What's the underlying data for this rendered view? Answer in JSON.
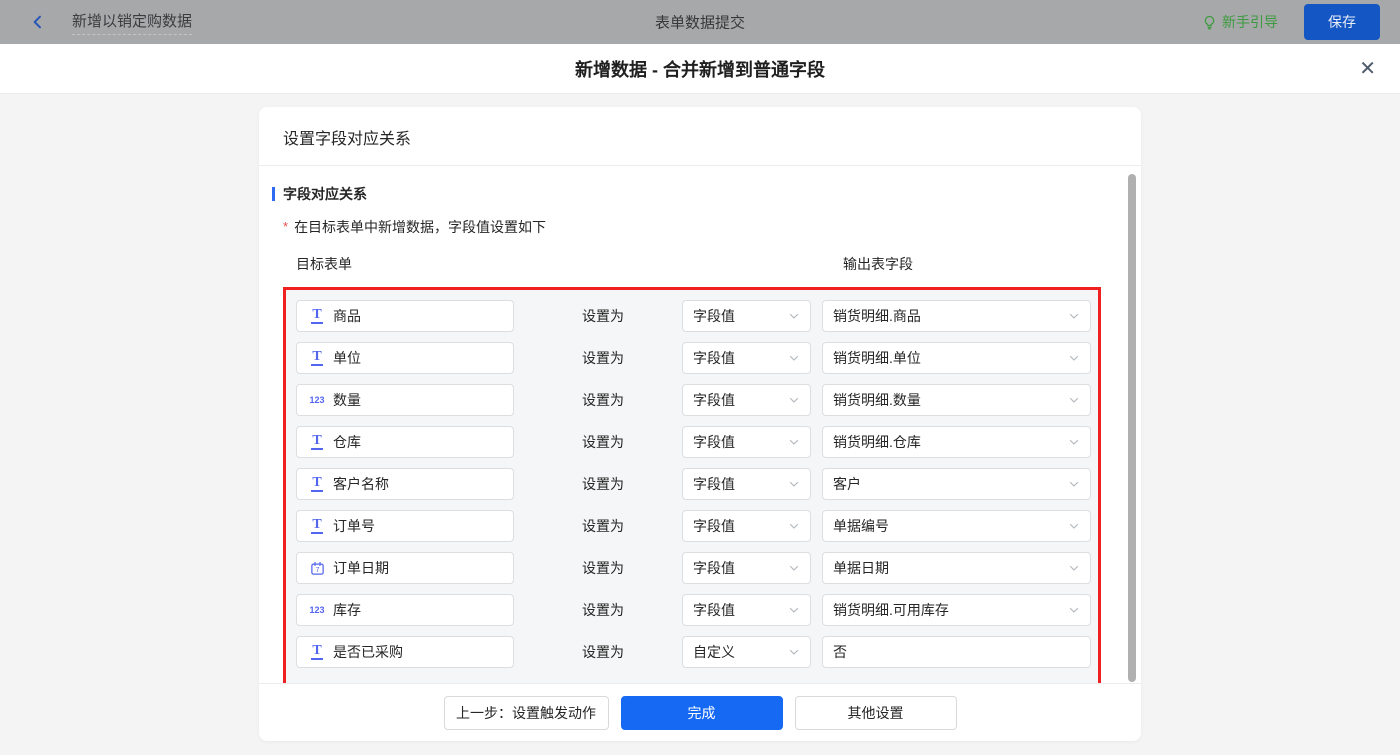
{
  "topbar": {
    "back_icon": "chevron-left",
    "flow_name": "新增以销定购数据",
    "center_title": "表单数据提交",
    "guide_icon": "lightbulb-icon",
    "guide_label": "新手引导",
    "save_label": "保存"
  },
  "modal": {
    "title": "新增数据 - 合并新增到普通字段",
    "close_glyph": "✕"
  },
  "card": {
    "header": "设置字段对应关系",
    "section_title": "字段对应关系",
    "required_star": "*",
    "required_note": "在目标表单中新增数据，字段值设置如下",
    "col_left": "目标表单",
    "col_right": "输出表字段",
    "set_as_label": "设置为",
    "rows": [
      {
        "icon": "text-field-icon",
        "field": "商品",
        "mode": "字段值",
        "value": "销货明细.商品",
        "value_is_select": true
      },
      {
        "icon": "text-field-icon",
        "field": "单位",
        "mode": "字段值",
        "value": "销货明细.单位",
        "value_is_select": true
      },
      {
        "icon": "number-field-icon",
        "field": "数量",
        "mode": "字段值",
        "value": "销货明细.数量",
        "value_is_select": true
      },
      {
        "icon": "text-field-icon",
        "field": "仓库",
        "mode": "字段值",
        "value": "销货明细.仓库",
        "value_is_select": true
      },
      {
        "icon": "text-field-icon",
        "field": "客户名称",
        "mode": "字段值",
        "value": "客户",
        "value_is_select": true
      },
      {
        "icon": "text-field-icon",
        "field": "订单号",
        "mode": "字段值",
        "value": "单据编号",
        "value_is_select": true
      },
      {
        "icon": "date-field-icon",
        "field": "订单日期",
        "mode": "字段值",
        "value": "单据日期",
        "value_is_select": true
      },
      {
        "icon": "number-field-icon",
        "field": "库存",
        "mode": "字段值",
        "value": "销货明细.可用库存",
        "value_is_select": true
      },
      {
        "icon": "text-field-icon",
        "field": "是否已采购",
        "mode": "自定义",
        "value": "否",
        "value_is_select": false
      }
    ],
    "footer": {
      "prev_label": "上一步：设置触发动作",
      "done_label": "完成",
      "other_label": "其他设置"
    }
  },
  "colors": {
    "topbar_bg": "#a7a8aa",
    "highlight_border": "#f02020",
    "primary_blue": "#1569f3",
    "save_blue": "#1356c4",
    "guide_green": "#3d9b3f",
    "field_icon_blue": "#5566ee",
    "section_bar_blue": "#2e6bf2"
  }
}
